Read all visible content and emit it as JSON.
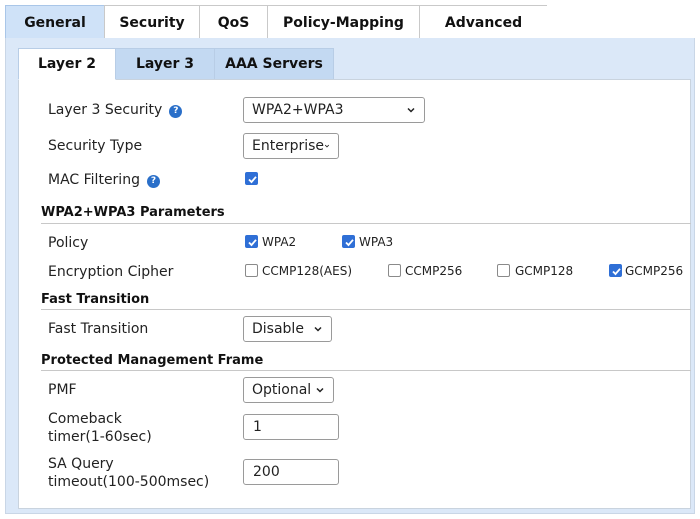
{
  "top_tabs": [
    "General",
    "Security",
    "QoS",
    "Policy-Mapping",
    "Advanced"
  ],
  "sub_tabs": [
    "Layer 2",
    "Layer 3",
    "AAA Servers"
  ],
  "colors": {
    "active_tab": "#cfe2f8",
    "panel_bg": "#dbe8f8",
    "checkbox_checked": "#2f6fd6",
    "help_icon": "#2a6fc9"
  },
  "form": {
    "layer3_security": {
      "label": "Layer 3 Security",
      "value": "WPA2+WPA3",
      "help_icon": "question-circle-icon"
    },
    "security_type": {
      "label": "Security Type",
      "value": "Enterprise"
    },
    "mac_filtering": {
      "label": "MAC Filtering",
      "checked": true,
      "help_icon": "question-circle-icon"
    }
  },
  "sections": {
    "wpa": "WPA2+WPA3 Parameters",
    "ft": "Fast Transition",
    "pmf": "Protected Management Frame"
  },
  "wpa_params": {
    "policy": {
      "label": "Policy",
      "options": [
        {
          "label": "WPA2",
          "checked": true
        },
        {
          "label": "WPA3",
          "checked": true
        }
      ]
    },
    "cipher": {
      "label": "Encryption Cipher",
      "options": [
        {
          "label": "CCMP128(AES)",
          "checked": false
        },
        {
          "label": "CCMP256",
          "checked": false
        },
        {
          "label": "GCMP128",
          "checked": false
        },
        {
          "label": "GCMP256",
          "checked": true
        }
      ]
    }
  },
  "fast_transition": {
    "label": "Fast Transition",
    "value": "Disable"
  },
  "pmf": {
    "pmf": {
      "label": "PMF",
      "value": "Optional"
    },
    "comeback_label_1": "Comeback",
    "comeback_label_2": "timer(1-60sec)",
    "comeback_value": "1",
    "sa_label_1": "SA Query",
    "sa_label_2": "timeout(100-500msec)",
    "sa_value": "200"
  }
}
